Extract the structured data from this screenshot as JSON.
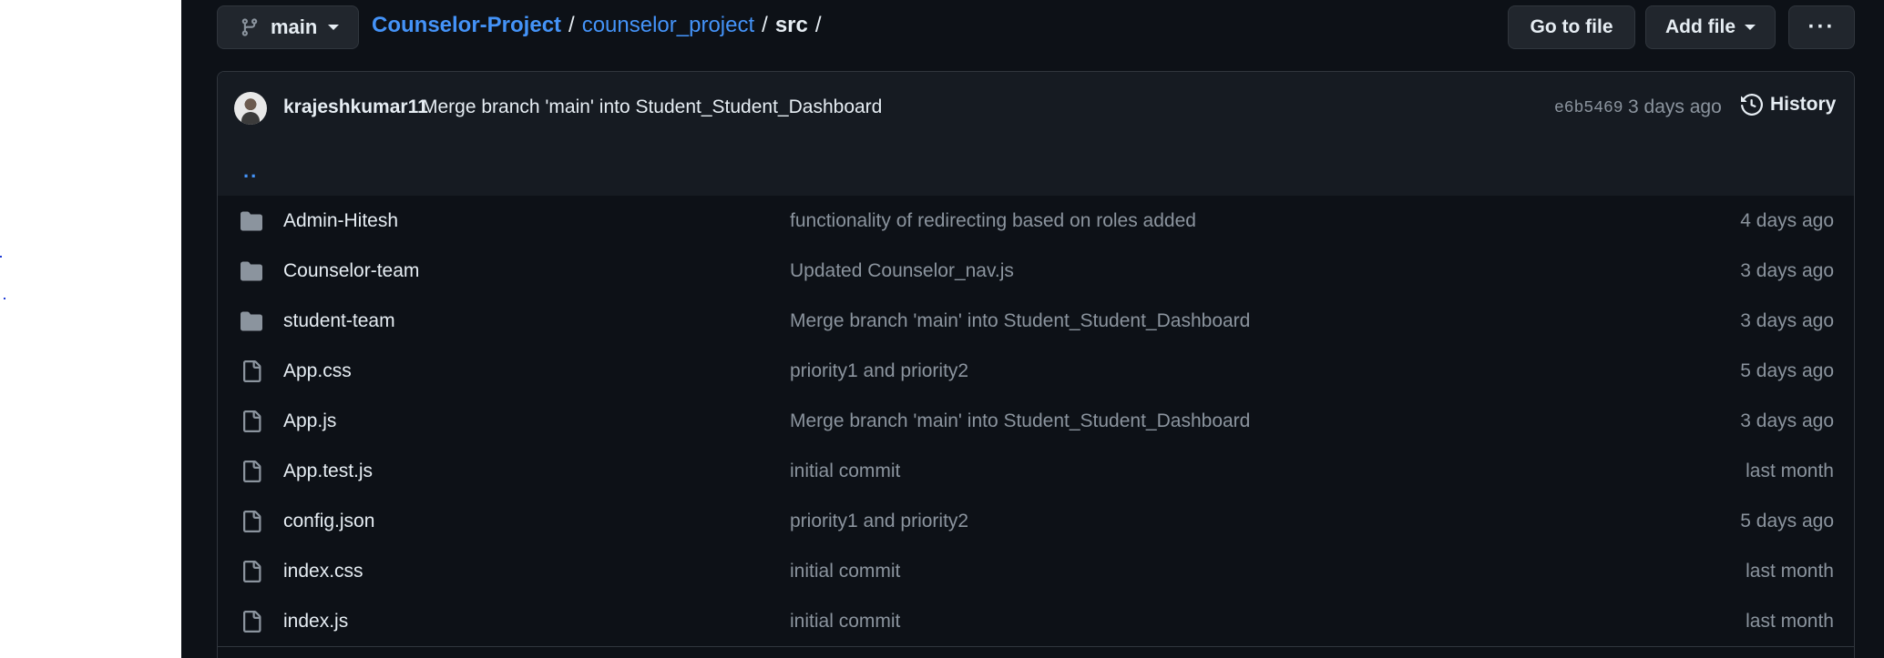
{
  "toolbar": {
    "branch": "main",
    "go_to_file": "Go to file",
    "add_file": "Add file",
    "more": "···"
  },
  "breadcrumb": {
    "repo": "Counselor-Project",
    "folder": "counselor_project",
    "current": "src",
    "separator": "/"
  },
  "latest_commit": {
    "author": "krajeshkumar11",
    "message": "Merge branch 'main' into Student_Student_Dashboard",
    "sha": "e6b5469",
    "time": "3 days ago",
    "history_label": "History"
  },
  "parent_link": "..",
  "files": [
    {
      "icon": "folder-icon",
      "name": "Admin-Hitesh",
      "message": "functionality of redirecting based on roles added",
      "time": "4 days ago"
    },
    {
      "icon": "folder-icon",
      "name": "Counselor-team",
      "message": "Updated Counselor_nav.js",
      "time": "3 days ago"
    },
    {
      "icon": "folder-icon",
      "name": "student-team",
      "message": "Merge branch 'main' into Student_Student_Dashboard",
      "time": "3 days ago"
    },
    {
      "icon": "file-icon",
      "name": "App.css",
      "message": "priority1 and priority2",
      "time": "5 days ago"
    },
    {
      "icon": "file-icon",
      "name": "App.js",
      "message": "Merge branch 'main' into Student_Student_Dashboard",
      "time": "3 days ago"
    },
    {
      "icon": "file-icon",
      "name": "App.test.js",
      "message": "initial commit",
      "time": "last month"
    },
    {
      "icon": "file-icon",
      "name": "config.json",
      "message": "priority1 and priority2",
      "time": "5 days ago"
    },
    {
      "icon": "file-icon",
      "name": "index.css",
      "message": "initial commit",
      "time": "last month"
    },
    {
      "icon": "file-icon",
      "name": "index.js",
      "message": "initial commit",
      "time": "last month"
    }
  ],
  "colors": {
    "background": "#0d1117",
    "link": "#4493f8",
    "muted": "#8b949e",
    "border": "#30363d"
  }
}
